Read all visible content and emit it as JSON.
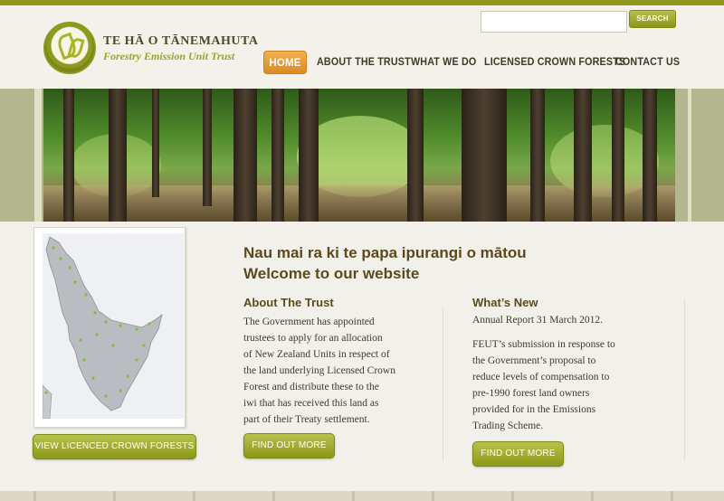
{
  "brand": {
    "title": "TE HĀ O TĀNEMAHUTA",
    "subtitle": "Forestry Emission Unit Trust",
    "logo_icon": "fern-leaf-icon"
  },
  "search": {
    "value": "",
    "placeholder": "",
    "button_label": "SEARCH"
  },
  "nav": {
    "items": [
      {
        "label": "HOME",
        "active": true
      },
      {
        "label": "ABOUT THE TRUST"
      },
      {
        "label": "WHAT WE DO"
      },
      {
        "label": "LICENSED CROWN FORESTS"
      },
      {
        "label": "CONTACT US"
      }
    ]
  },
  "map_button_label": "VIEW LICENCED CROWN FORESTS",
  "welcome": {
    "line1": "Nau mai ra ki te papa ipurangi o mātou",
    "line2": "Welcome to our website"
  },
  "about": {
    "heading": "About The Trust",
    "body": "The Government has appointed\ntrustees to apply for an allocation\nof New Zealand Units in respect of\nthe land underlying Licensed Crown\nForest and distribute these to the\niwi that has received this land as\npart of their Treaty settlement.",
    "button_label": "FIND OUT MORE"
  },
  "news": {
    "heading": "What’s New",
    "item1": "Annual Report 31 March 2012.",
    "item2": "FEUT’s submission in response to\nthe Government’s proposal to\nreduce levels of compensation to\npre-1990 forest land owners\nprovided for in the Emissions\nTrading Scheme.",
    "button_label": "FIND OUT MORE"
  },
  "colors": {
    "accent_olive": "#8e981a",
    "nav_active_orange": "#e59a2f",
    "heading_brown": "#5a4a1c",
    "background": "#f2f0ea"
  }
}
